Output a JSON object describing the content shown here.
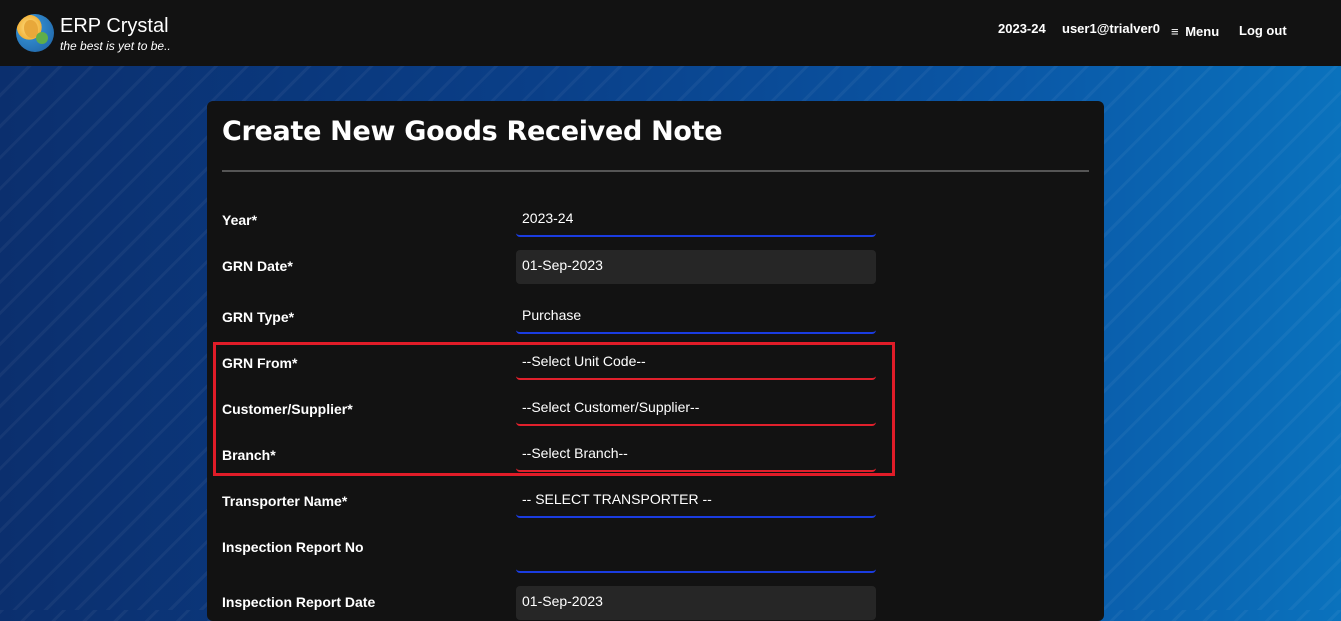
{
  "header": {
    "brand_name": "ERP Crystal",
    "tagline": "the best is yet to be..",
    "year": "2023-24",
    "user": "user1@trialver0",
    "menu_label": "Menu",
    "menu_icon": "≡",
    "logout_label": "Log out"
  },
  "form": {
    "title": "Create New Goods Received Note",
    "fields": {
      "year": {
        "label": "Year*",
        "value": "2023-24"
      },
      "grn_date": {
        "label": "GRN Date*",
        "value": "01-Sep-2023"
      },
      "grn_type": {
        "label": "GRN Type*",
        "value": "Purchase"
      },
      "grn_from": {
        "label": "GRN From*",
        "value": "--Select Unit Code--"
      },
      "customer_supplier": {
        "label": "Customer/Supplier*",
        "value": "--Select Customer/Supplier--"
      },
      "branch": {
        "label": "Branch*",
        "value": "--Select Branch--"
      },
      "transporter": {
        "label": "Transporter Name*",
        "value": "-- SELECT TRANSPORTER --"
      },
      "inspection_no": {
        "label": "Inspection Report No",
        "value": ""
      },
      "inspection_date": {
        "label": "Inspection Report Date",
        "value": "01-Sep-2023"
      }
    }
  },
  "colors": {
    "accent_underline": "#1a3ce0",
    "error_underline": "#e0202c",
    "highlight_box": "#e01c28"
  }
}
